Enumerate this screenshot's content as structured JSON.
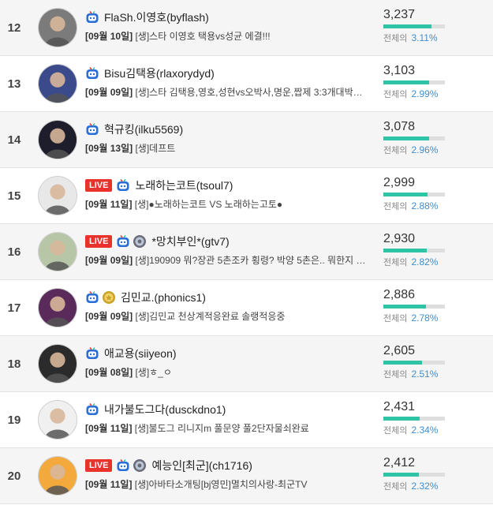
{
  "colors": {
    "live": "#e8322b",
    "bar_fill": "#2ec4a5",
    "percent": "#3d8fd0"
  },
  "total_label": "전체의",
  "rows": [
    {
      "rank": "12",
      "live": false,
      "live_label": "",
      "badges": [
        "tv-badge-icon"
      ],
      "name": "FlaSh.이영호(byflash)",
      "date": "[09월 10일]",
      "title": "[생]스타 이영호 택용vs성균 에결!!!",
      "count": "3,237",
      "percent": "3.11%",
      "share": 0.311
    },
    {
      "rank": "13",
      "live": false,
      "live_label": "",
      "badges": [
        "tv-badge-icon"
      ],
      "name": "Bisu김택용(rlaxorydyd)",
      "date": "[09월 09일]",
      "title": "[생]스타 김택용,영호,성현vs오박사,명운,짭제 3:3개대박…",
      "count": "3,103",
      "percent": "2.99%",
      "share": 0.299
    },
    {
      "rank": "14",
      "live": false,
      "live_label": "",
      "badges": [
        "tv-badge-icon"
      ],
      "name": "혁규킹(ilku5569)",
      "date": "[09월 13일]",
      "title": "[생]데프트",
      "count": "3,078",
      "percent": "2.96%",
      "share": 0.296
    },
    {
      "rank": "15",
      "live": true,
      "live_label": "LIVE",
      "badges": [
        "tv-badge-icon"
      ],
      "name": "노래하는코트(tsoul7)",
      "date": "[09월 11일]",
      "title": "[생]●노래하는코트 VS 노래하는고토●",
      "count": "2,999",
      "percent": "2.88%",
      "share": 0.288
    },
    {
      "rank": "16",
      "live": true,
      "live_label": "LIVE",
      "badges": [
        "tv-badge-icon",
        "fan-badge-icon"
      ],
      "name": "*망치부인*(gtv7)",
      "date": "[09월 09일]",
      "title": "[생]190909 뭐?장관 5촌조카 횡령? 박양 5촌은.. 뭐한지 …",
      "count": "2,930",
      "percent": "2.82%",
      "share": 0.282
    },
    {
      "rank": "17",
      "live": false,
      "live_label": "",
      "badges": [
        "tv-badge-icon",
        "gold-badge-icon"
      ],
      "name": "김민교.(phonics1)",
      "date": "[09월 09일]",
      "title": "[생]김민교 천상계적응완료 솔랭적응중",
      "count": "2,886",
      "percent": "2.78%",
      "share": 0.278
    },
    {
      "rank": "18",
      "live": false,
      "live_label": "",
      "badges": [
        "tv-badge-icon"
      ],
      "name": "애교용(siiyeon)",
      "date": "[09월 08일]",
      "title": "[생]ㅎ_ㅇ",
      "count": "2,605",
      "percent": "2.51%",
      "share": 0.251
    },
    {
      "rank": "19",
      "live": false,
      "live_label": "",
      "badges": [
        "tv-badge-icon"
      ],
      "name": "내가불도그다(dusckdno1)",
      "date": "[09월 11일]",
      "title": "[생]불도그 리니지m 풀문양 풀2단자물쇠완료",
      "count": "2,431",
      "percent": "2.34%",
      "share": 0.234
    },
    {
      "rank": "20",
      "live": true,
      "live_label": "LIVE",
      "badges": [
        "tv-badge-icon",
        "fan-badge-icon"
      ],
      "name": "예능인[최군](ch1716)",
      "date": "[09월 11일]",
      "title": "[생]아바타소개팅[bj영민]멸치의사랑-최군TV",
      "count": "2,412",
      "percent": "2.32%",
      "share": 0.232
    }
  ]
}
